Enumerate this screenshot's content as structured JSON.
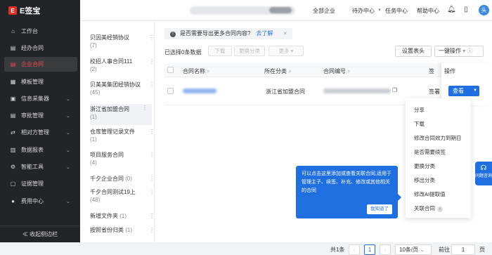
{
  "app": {
    "name": "E签宝",
    "logo_letter": "E"
  },
  "topbar": {
    "enterprise": "全部企业",
    "todo": "待办中心",
    "tasks": "任务中心",
    "help": "帮助中心",
    "avatar_text": "头"
  },
  "sidebar": {
    "items": [
      {
        "label": "工作台",
        "icon": "home-icon"
      },
      {
        "label": "经办合同",
        "icon": "doc-icon"
      },
      {
        "label": "企业合同",
        "icon": "contract-icon",
        "active": true
      },
      {
        "label": "模板管理",
        "icon": "template-icon"
      },
      {
        "label": "信息采集器",
        "icon": "collect-icon",
        "expandable": true
      },
      {
        "label": "审批管理",
        "icon": "approval-icon",
        "expandable": true
      },
      {
        "label": "相对方管理",
        "icon": "party-icon",
        "expandable": true
      },
      {
        "label": "数据报表",
        "icon": "report-icon",
        "expandable": true
      },
      {
        "label": "智能工具",
        "icon": "tool-icon",
        "expandable": true
      },
      {
        "label": "证据管理",
        "icon": "evidence-icon"
      },
      {
        "label": "费用中心",
        "icon": "fee-icon",
        "expandable": true
      }
    ],
    "collapse_label": "≪ 收起侧边栏"
  },
  "folders": [
    {
      "name": "贝因美经销协议",
      "count": "(7)"
    },
    {
      "name": "校招人事合同111",
      "count": "(2)"
    },
    {
      "name": "贝美美集团经销协议",
      "count": "(45)"
    },
    {
      "name": "浙江省加盟合同",
      "count": "(1)",
      "selected": true
    },
    {
      "name": "仓库管理记录文件",
      "count": "(1)"
    },
    {
      "name": "项目服务合同",
      "count": "(4)"
    },
    {
      "name": "千夕企业合同",
      "count": "(0)"
    },
    {
      "name": "千夕合同测试19上",
      "count": "(48)"
    },
    {
      "name": "新增文件夹",
      "count": "(1)"
    },
    {
      "name": "按照省份归类",
      "count": "(1)"
    }
  ],
  "banner": {
    "text": "是否需要导出更多合同内容?",
    "link": "去了解",
    "close": "×"
  },
  "toolbar": {
    "selected_info": "已选择0条数据",
    "download": "下载",
    "change_category": "更换分类",
    "more": "更多 ▾",
    "set_header": "设置表头",
    "bulk_ops": "一键操作"
  },
  "table": {
    "headers": {
      "name": "合同名称",
      "category": "所在分类",
      "number": "合同编号",
      "status": "签",
      "ops": "操作"
    },
    "rows": [
      {
        "category": "浙江省加盟合同",
        "status": "签署"
      }
    ]
  },
  "row_actions": {
    "view": "查看"
  },
  "menu": [
    {
      "label": "分享"
    },
    {
      "label": "下载"
    },
    {
      "label": "修改合同效力到期日"
    },
    {
      "label": "是否需要续签"
    },
    {
      "label": "更换分类"
    },
    {
      "label": "移出分类"
    },
    {
      "label": "修改AI提取值"
    },
    {
      "label": "关联合同",
      "badge": "i"
    }
  ],
  "tooltip": {
    "text": "可以点击这里添加或查看关联合同,适用于管理主子、续签、补充、修改或其他相关的合同",
    "ok": "我知道了"
  },
  "help_widget": {
    "label": "问题咨询"
  },
  "pagination": {
    "total": "共1条",
    "current_page": "1",
    "page_size": "10条/页",
    "goto_label": "前往",
    "goto_value": "1",
    "page_unit": "页"
  }
}
